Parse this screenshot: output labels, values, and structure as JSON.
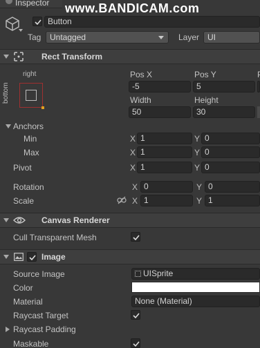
{
  "window": {
    "tab_title": "Inspector",
    "watermark": "www.BANDICAM.com"
  },
  "header": {
    "active": true,
    "object_name": "Button",
    "tag_label": "Tag",
    "tag_value": "Untagged",
    "layer_label": "Layer",
    "layer_value": "UI"
  },
  "rect_transform": {
    "title": "Rect Transform",
    "anchor_preset_top": "right",
    "anchor_preset_side": "bottom",
    "pos_x_label": "Pos X",
    "pos_y_label": "Pos Y",
    "pos_z_label": "P",
    "pos_x": "-5",
    "pos_y": "5",
    "width_label": "Width",
    "height_label": "Height",
    "width": "50",
    "height": "30",
    "anchors_label": "Anchors",
    "min_label": "Min",
    "max_label": "Max",
    "x_label": "X",
    "y_label": "Y",
    "anchor_min_x": "1",
    "anchor_min_y": "0",
    "anchor_max_x": "1",
    "anchor_max_y": "0",
    "pivot_label": "Pivot",
    "pivot_x": "1",
    "pivot_y": "0",
    "rotation_label": "Rotation",
    "rotation_x": "0",
    "rotation_y": "0",
    "scale_label": "Scale",
    "scale_x": "1",
    "scale_y": "1"
  },
  "canvas_renderer": {
    "title": "Canvas Renderer",
    "cull_label": "Cull Transparent Mesh",
    "cull_checked": true
  },
  "image": {
    "title": "Image",
    "enabled": true,
    "source_label": "Source Image",
    "source_value": "UISprite",
    "color_label": "Color",
    "color_value": "#ffffff",
    "material_label": "Material",
    "material_value": "None (Material)",
    "raycast_target_label": "Raycast Target",
    "raycast_target_checked": true,
    "raycast_padding_label": "Raycast Padding",
    "maskable_label": "Maskable",
    "maskable_checked": true
  },
  "colors": {
    "bg": "#383838",
    "section_bg": "#3e3e3e",
    "field_bg": "#2a2a2a",
    "anchor_box": "#a03030",
    "anchor_dot": "#e0a020"
  }
}
